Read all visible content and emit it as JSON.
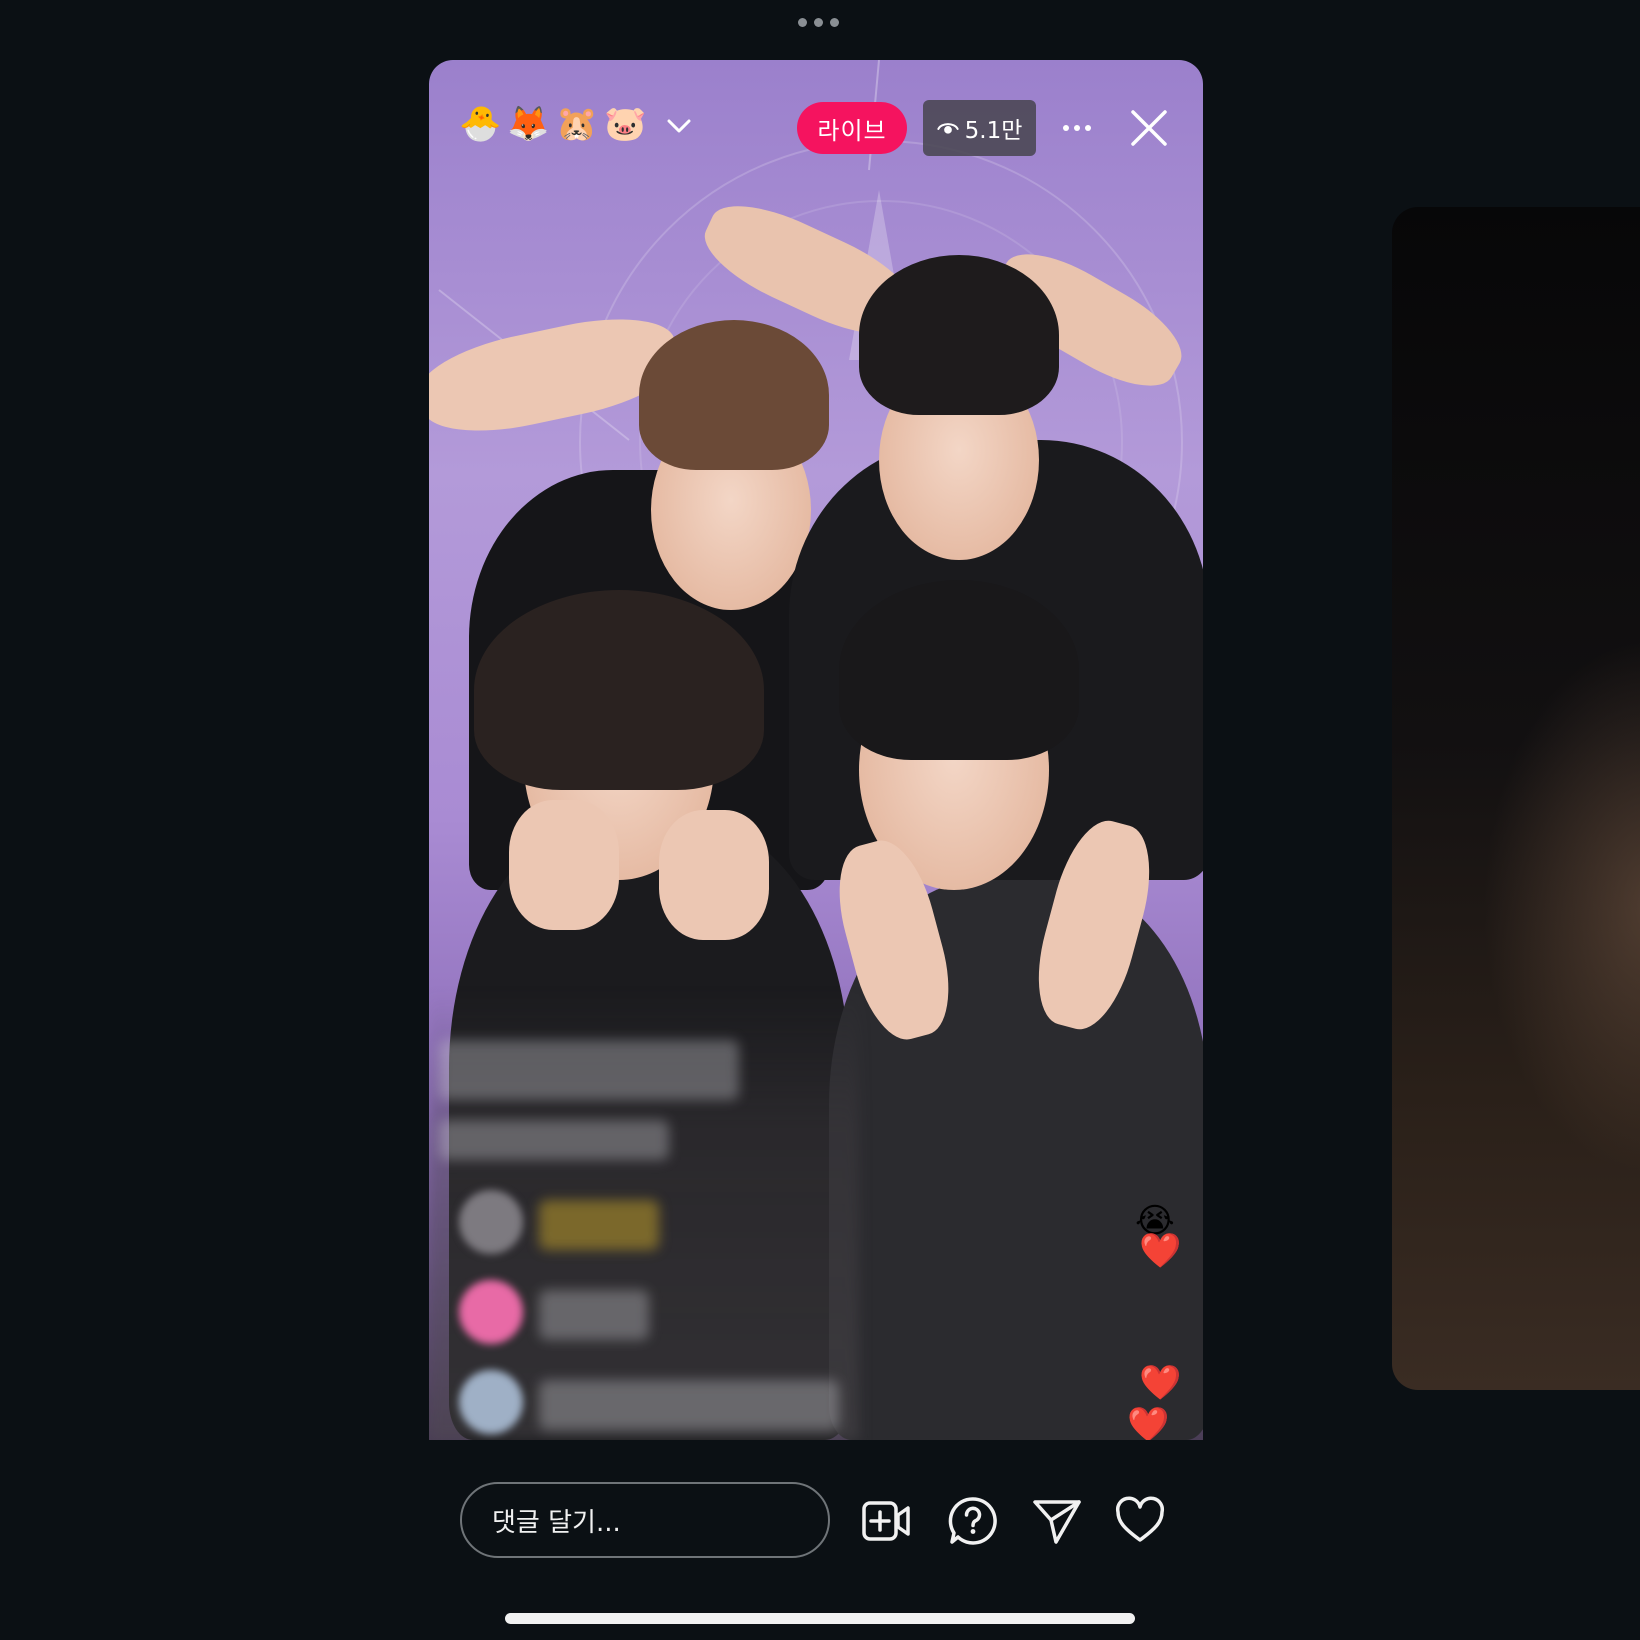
{
  "header": {
    "host_emojis": [
      "🐣",
      "🦊",
      "🐹",
      "🐷"
    ],
    "live_label": "라이브",
    "viewer_count": "5.1만"
  },
  "reactions": {
    "floating": [
      "😭",
      "❤️",
      "❤️",
      "❤️"
    ]
  },
  "footer": {
    "comment_placeholder": "댓글 달기..."
  },
  "colors": {
    "live_badge": "#f5135f",
    "background": "#0b1014"
  },
  "icons": {
    "chevron": "chevron-down-icon",
    "viewer": "eye-icon",
    "more": "more-icon",
    "close": "close-icon",
    "add_video": "add-video-icon",
    "question": "question-icon",
    "share": "send-icon",
    "like": "heart-icon"
  }
}
